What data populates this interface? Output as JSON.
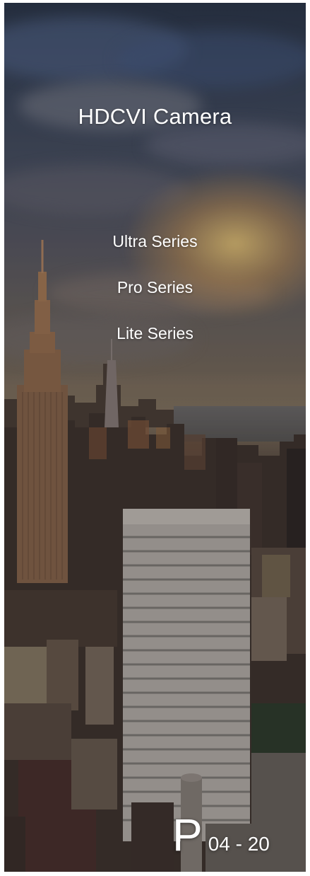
{
  "page": {
    "title": "HDCVI Camera"
  },
  "menu": {
    "items": [
      {
        "label": "Ultra Series"
      },
      {
        "label": "Pro Series"
      },
      {
        "label": "Lite Series"
      }
    ]
  },
  "page_indicator": {
    "letter": "P",
    "range": "04 - 20"
  },
  "background": {
    "image": "city-skyline-sunset-photo"
  },
  "colors": {
    "text": "#ffffff"
  }
}
